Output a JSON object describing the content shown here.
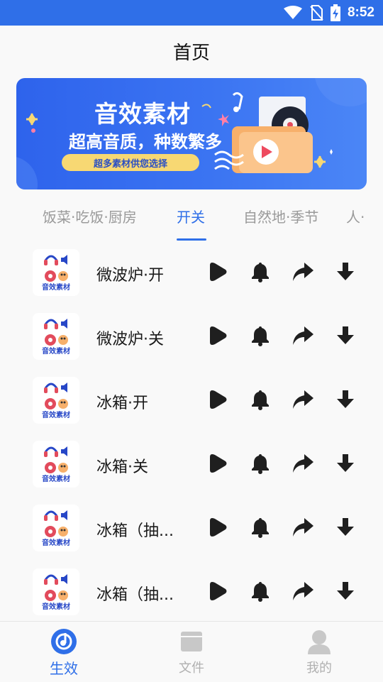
{
  "status_bar": {
    "time": "8:52",
    "icons": [
      "wifi-icon",
      "no-sim-icon",
      "battery-charging-icon"
    ]
  },
  "header": {
    "title": "首页"
  },
  "banner": {
    "title": "音效素材",
    "subtitle": "超高音质，种数繁多",
    "pill": "超多素材供您选择"
  },
  "tabs": [
    {
      "label": "饭菜·吃饭·厨房",
      "active": false
    },
    {
      "label": "开关",
      "active": true
    },
    {
      "label": "自然地·季节",
      "active": false
    },
    {
      "label": "人·",
      "active": false
    }
  ],
  "items": [
    {
      "title": "微波炉·开",
      "thumb_caption": "音效素材"
    },
    {
      "title": "微波炉·关",
      "thumb_caption": "音效素材"
    },
    {
      "title": "冰箱·开",
      "thumb_caption": "音效素材"
    },
    {
      "title": "冰箱·关",
      "thumb_caption": "音效素材"
    },
    {
      "title": "冰箱（抽...",
      "thumb_caption": "音效素材"
    },
    {
      "title": "冰箱（抽...",
      "thumb_caption": "音效素材"
    }
  ],
  "item_actions": [
    "play-icon",
    "bell-icon",
    "share-icon",
    "download-icon"
  ],
  "bottom_nav": [
    {
      "label": "生效",
      "icon": "music-disc-icon",
      "active": true
    },
    {
      "label": "文件",
      "icon": "folder-icon",
      "active": false
    },
    {
      "label": "我的",
      "icon": "person-icon",
      "active": false
    }
  ],
  "colors": {
    "accent": "#2f6fe8",
    "banner_pill": "#f7d873",
    "icon_dark": "#1f1f1f",
    "inactive": "#b0b0b0"
  }
}
